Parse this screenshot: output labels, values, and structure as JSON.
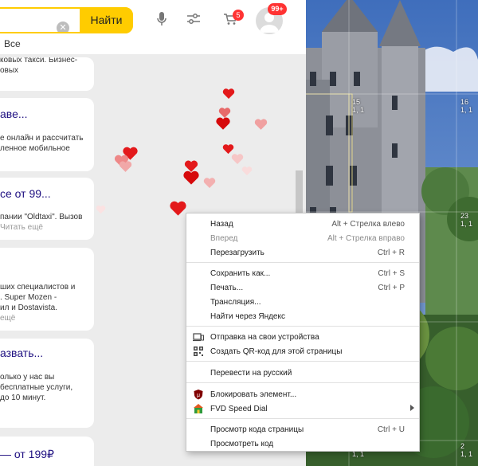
{
  "search": {
    "button_label": "Найти",
    "clear_icon": "clear-icon"
  },
  "header": {
    "cart_count": "5",
    "avatar_badge": "99+",
    "tab_all": "Все"
  },
  "results": [
    {
      "title": "",
      "lines": [
        "ковых такси. Бизнес-",
        "овых"
      ],
      "more": ""
    },
    {
      "title": "аве...",
      "lines": [
        "е онлайн и рассчитать",
        "ленное мобильное"
      ],
      "more": ""
    },
    {
      "title": "се от 99...",
      "lines": [
        "пании \"Oldtaxi\". Вызов"
      ],
      "more": "Читать ещё"
    },
    {
      "title": "",
      "lines": [
        "ших специалистов и",
        ". Super Mozen -",
        "ил и Dostavista."
      ],
      "more": "ещё"
    },
    {
      "title": "азвать...",
      "lines": [
        "олько у нас вы",
        "бесплатные услуги,",
        "до 10 минут."
      ],
      "more": ""
    },
    {
      "title": "— от 199₽",
      "lines": [],
      "more": ""
    }
  ],
  "tiles": [
    {
      "num": "15",
      "sub": "1, 1"
    },
    {
      "num": "16",
      "sub": "1, 1"
    },
    {
      "num": "23",
      "sub": "1, 1"
    },
    {
      "num": "1",
      "sub": "1, 1"
    },
    {
      "num": "2",
      "sub": "1, 1"
    }
  ],
  "context_menu": {
    "back": {
      "label": "Назад",
      "shortcut": "Alt + Стрелка влево"
    },
    "forward": {
      "label": "Вперед",
      "shortcut": "Alt + Стрелка вправо"
    },
    "reload": {
      "label": "Перезагрузить",
      "shortcut": "Ctrl + R"
    },
    "save_as": {
      "label": "Сохранить как...",
      "shortcut": "Ctrl + S"
    },
    "print": {
      "label": "Печать...",
      "shortcut": "Ctrl + P"
    },
    "cast": {
      "label": "Трансляция..."
    },
    "search_yandex": {
      "label": "Найти через Яндекс"
    },
    "send_devices": {
      "label": "Отправка на свои устройства"
    },
    "qr_code": {
      "label": "Создать QR-код для этой страницы"
    },
    "translate": {
      "label": "Перевести на русский"
    },
    "block_element": {
      "label": "Блокировать элемент..."
    },
    "fvd_speed_dial": {
      "label": "FVD Speed Dial"
    },
    "view_source": {
      "label": "Просмотр кода страницы",
      "shortcut": "Ctrl + U"
    },
    "inspect": {
      "label": "Просмотреть код"
    }
  },
  "colors": {
    "accent_yellow": "#ffcc00",
    "link_purple": "#1d0e80",
    "badge_red": "#ff3333",
    "heart_red": "#e3191b"
  }
}
